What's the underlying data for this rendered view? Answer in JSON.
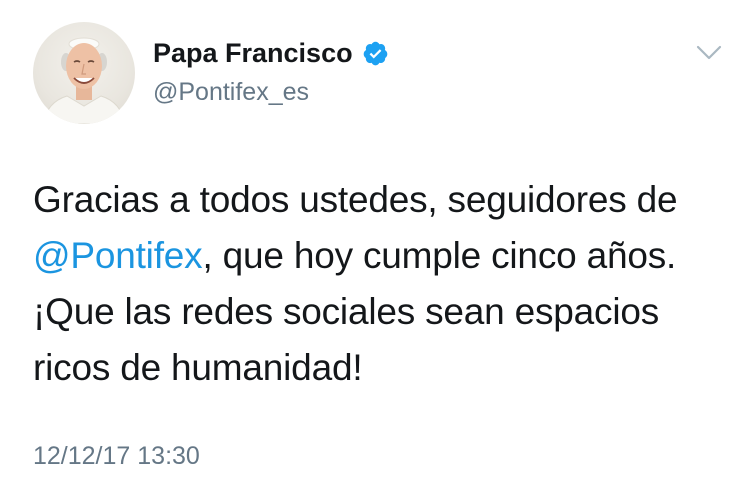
{
  "author": {
    "display_name": "Papa Francisco",
    "handle": "@Pontifex_es",
    "verified_icon": "verified-badge-icon",
    "avatar_icon": "avatar-image"
  },
  "tweet": {
    "text_part1": "Gracias a todos ustedes, seguidores de ",
    "mention": "@Pontifex",
    "text_part2": ", que hoy cumple cinco años. ¡Que las redes sociales sean espacios ricos de humanidad!",
    "timestamp": "12/12/17 13:30"
  },
  "colors": {
    "text": "#14171a",
    "secondary": "#657786",
    "link": "#1b95e0",
    "verified": "#1da1f2"
  }
}
